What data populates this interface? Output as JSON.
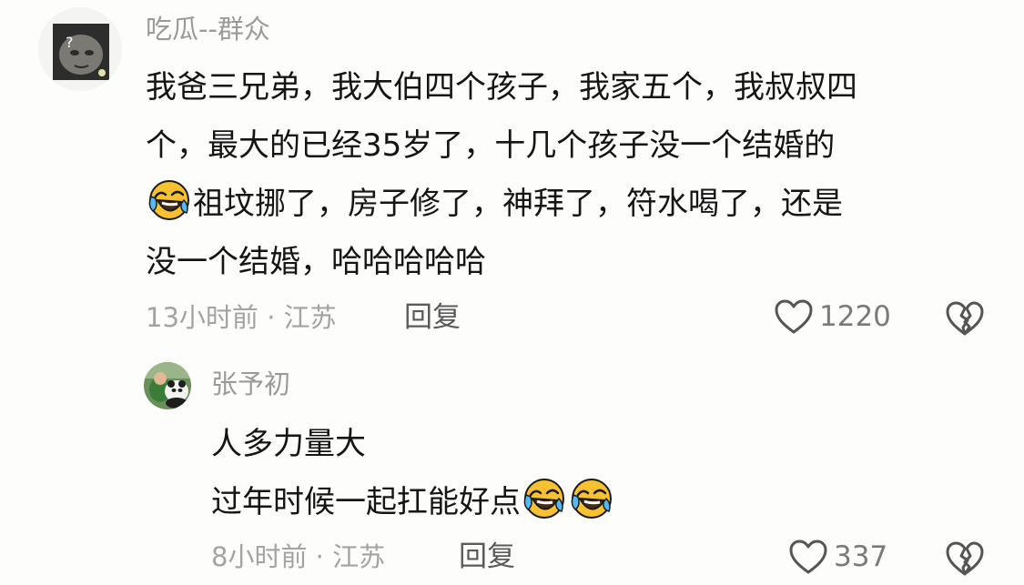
{
  "comment": {
    "username": "吃瓜--群众",
    "lines": [
      "我爸三兄弟，我大伯四个孩子，我家五个，我叔叔四",
      "个，最大的已经35岁了，十几个孩子没一个结婚的",
      "祖坟挪了，房子修了，神拜了，符水喝了，还是",
      "没一个结婚，哈哈哈哈哈"
    ],
    "time": "13小时前",
    "separator": "·",
    "location": "江苏",
    "reply_label": "回复",
    "like_count": "1220",
    "emoji_icon": "laughing-crying-emoji"
  },
  "reply": {
    "username": "张予初",
    "lines": [
      "人多力量大",
      "过年时候一起扛能好点"
    ],
    "time": "8小时前",
    "separator": "·",
    "location": "江苏",
    "reply_label": "回复",
    "like_count": "337",
    "emoji_icon": "laughing-crying-emoji"
  },
  "colors": {
    "background": "#fdfdfb",
    "meta_text": "#a3a3a3",
    "username_text": "#9a9a9a",
    "emoji_yellow": "#f7c132"
  }
}
